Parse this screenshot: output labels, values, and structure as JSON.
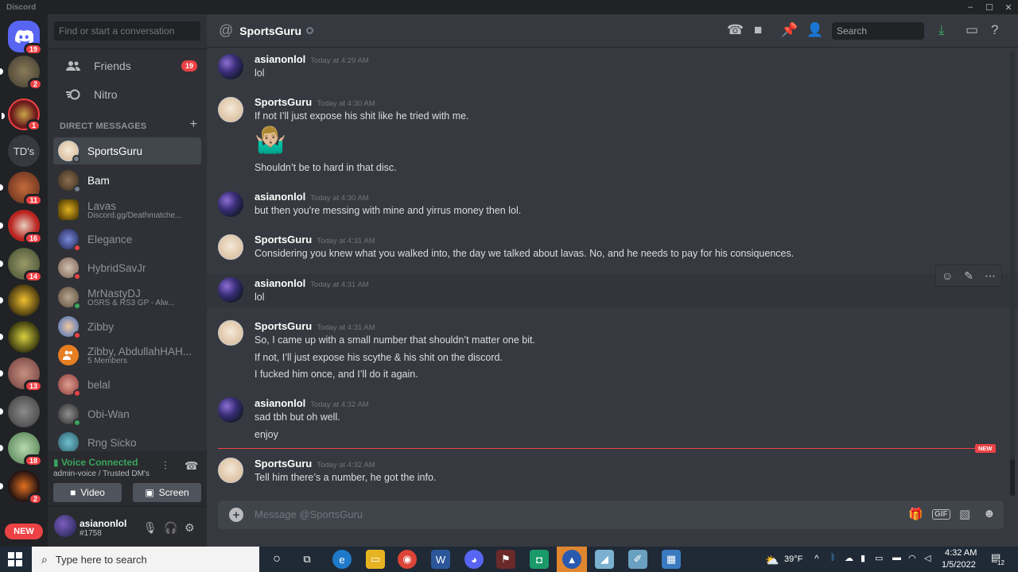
{
  "window": {
    "app_name": "Discord",
    "controls": [
      "–",
      "☐",
      "✕"
    ]
  },
  "servers": [
    {
      "name": "Home",
      "badge": "19"
    },
    {
      "name": "server-1",
      "badge": "2"
    },
    {
      "name": "server-2",
      "badge": "1"
    },
    {
      "name": "TD's",
      "badge": ""
    },
    {
      "name": "server-4",
      "badge": "11"
    },
    {
      "name": "server-5",
      "badge": "16"
    },
    {
      "name": "server-6",
      "badge": "14"
    },
    {
      "name": "server-7",
      "badge": ""
    },
    {
      "name": "server-8",
      "badge": ""
    },
    {
      "name": "server-9",
      "badge": "13"
    },
    {
      "name": "server-10",
      "badge": ""
    },
    {
      "name": "server-11",
      "badge": "18"
    },
    {
      "name": "server-12",
      "badge": "2"
    }
  ],
  "rail_new_label": "NEW",
  "sidebar": {
    "search_placeholder": "Find or start a conversation",
    "friends_label": "Friends",
    "friends_badge": "19",
    "nitro_label": "Nitro",
    "dm_header": "DIRECT MESSAGES",
    "dm_add": "+",
    "dms": [
      {
        "name": "SportsGuru",
        "sub": "",
        "status": "#747f8d"
      },
      {
        "name": "Bam",
        "sub": "",
        "status": "#747f8d"
      },
      {
        "name": "Lavas",
        "sub": "Discord.gg/Deathmatche...",
        "status": ""
      },
      {
        "name": "Elegance",
        "sub": "",
        "status": "#ed4245"
      },
      {
        "name": "HybridSavJr",
        "sub": "",
        "status": "#ed4245"
      },
      {
        "name": "MrNastyDJ",
        "sub": "OSRS & RS3 GP - Alw...",
        "status": "#3ba55d"
      },
      {
        "name": "Zibby",
        "sub": "",
        "status": "#ed4245"
      },
      {
        "name": "Zibby, AbdullahHAH...",
        "sub": "5 Members",
        "status": ""
      },
      {
        "name": "belal",
        "sub": "",
        "status": "#ed4245"
      },
      {
        "name": "Obi-Wan",
        "sub": "",
        "status": "#3ba55d"
      },
      {
        "name": "Rng Sicko",
        "sub": "",
        "status": ""
      }
    ]
  },
  "voice": {
    "status": "Voice Connected",
    "channel": "admin-voice / Trusted DM's",
    "video_label": "Video",
    "screen_label": "Screen"
  },
  "user": {
    "name": "asianonlol",
    "tag": "#1758"
  },
  "chat": {
    "at_symbol": "@",
    "title": "SportsGuru",
    "search_placeholder": "Search",
    "new_marker": "NEW",
    "composer_placeholder": "Message @SportsGuru",
    "messages": [
      {
        "author": "asianonlol",
        "time": "Today at 4:29 AM",
        "lines": [
          "lol"
        ]
      },
      {
        "author": "SportsGuru",
        "time": "Today at 4:30 AM",
        "lines": [
          "If not I’ll just expose his shit like he tried with me.",
          "🤷🏼‍♂️",
          "Shouldn’t be to hard in that disc."
        ]
      },
      {
        "author": "asianonlol",
        "time": "Today at 4:30 AM",
        "lines": [
          "but then you're messing with mine and yirrus money then lol."
        ]
      },
      {
        "author": "SportsGuru",
        "time": "Today at 4:31 AM",
        "lines": [
          "Considering you knew what you walked into, the day we talked about lavas. No, and he needs to pay for his consiquences."
        ]
      },
      {
        "author": "asianonlol",
        "time": "Today at 4:31 AM",
        "lines": [
          "lol"
        ]
      },
      {
        "author": "SportsGuru",
        "time": "Today at 4:31 AM",
        "lines": [
          "So, I came up with a small number that shouldn’t matter one bit.",
          "If not, I’ll just expose his scythe & his shit on the discord.",
          "I fucked him once, and I’ll do it again."
        ]
      },
      {
        "author": "asianonlol",
        "time": "Today at 4:32 AM",
        "lines": [
          "sad tbh but oh well.",
          "enjoy"
        ]
      },
      {
        "author": "SportsGuru",
        "time": "Today at 4:32 AM",
        "lines": [
          "Tell him there’s a number, he got the info."
        ]
      }
    ]
  },
  "taskbar": {
    "search_placeholder": "Type here to search",
    "weather": "39°F",
    "time": "4:32 AM",
    "date": "1/5/2022",
    "notifications": "12"
  }
}
